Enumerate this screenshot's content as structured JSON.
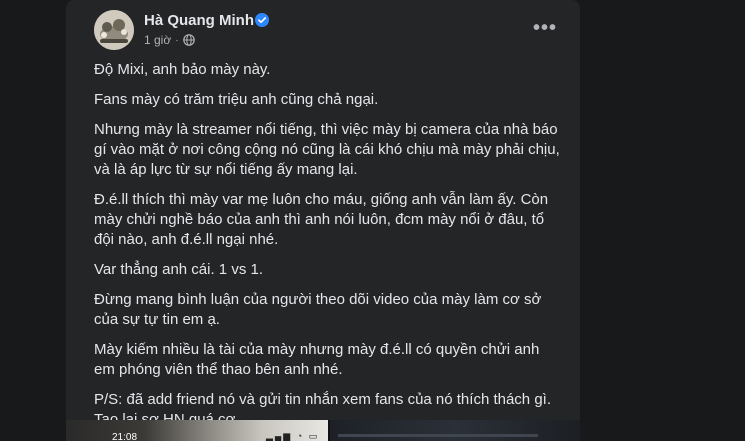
{
  "post": {
    "author": {
      "name": "Hà Quang Minh",
      "verified": true,
      "avatar_icon": "avatar-photo"
    },
    "meta": {
      "time": "1 giờ",
      "separator": "·",
      "privacy_icon": "globe-icon"
    },
    "more_icon": "more-options-icon",
    "more_label": "•••",
    "paragraphs": [
      "Độ Mixi, anh bảo mày này.",
      "Fans mày có trăm triệu anh cũng chả ngại.",
      "Nhưng mày là streamer nổi tiếng, thì việc mày bị camera của nhà báo gí vào mặt ở nơi công cộng nó cũng là cái khó chịu mà mày phải chịu, và là áp lực từ sự nổi tiếng ấy mang lại.",
      "Đ.é.ll thích thì mày var mẹ luôn cho máu, giống anh vẫn làm ấy. Còn mày chửi nghề báo của anh thì anh nói luôn, đcm mày nổi ở đâu, tổ đội nào, anh đ.é.ll ngại nhé.",
      "Var thẳng anh cái. 1 vs 1.",
      "Đừng mang bình luận của người theo dõi video của mày làm cơ sở của sự tự tin em ạ.",
      "Mày kiếm nhiều là tài của mày nhưng mày đ.é.ll có quyền chửi anh em phóng viên thể thao bên anh nhé.",
      "P/S: đã add friend nó và gửi tin nhắn xem fans của nó thích thách gì. Tao lại sợ HN quá cơ"
    ],
    "media": {
      "left_time": "21:08"
    }
  },
  "colors": {
    "page_background": "#18191a",
    "card_background": "#242526",
    "primary_text": "#e4e6eb",
    "secondary_text": "#b0b3b8",
    "verified_blue": "#2d88ff"
  }
}
